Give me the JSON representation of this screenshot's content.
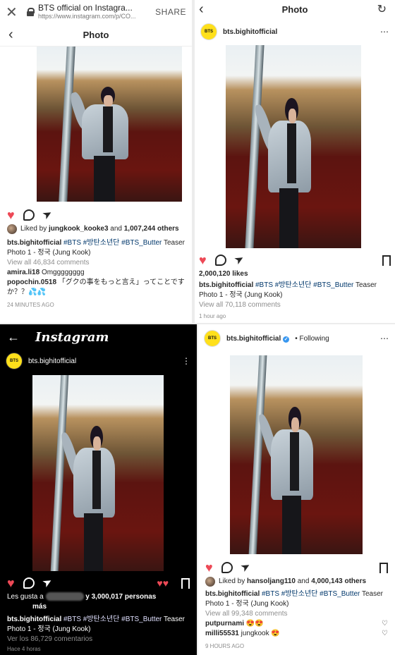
{
  "p1": {
    "browser_title": "BTS official on Instagra...",
    "browser_url": "https://www.instagram.com/p/CO...",
    "share_label": "SHARE",
    "nav_title": "Photo",
    "liked_by_prefix": "Liked by",
    "liked_by_user": "jungkook_kooke3",
    "liked_by_and": "and",
    "liked_by_count": "1,007,244 others",
    "caption_user": "bts.bighitofficial",
    "caption_tags": "#BTS #방탄소년단 #BTS_Butter",
    "caption_rest1": "Teaser",
    "caption_rest2": "Photo 1 - 정국 (Jung Kook)",
    "view_all": "View all 46,834 comments",
    "c1_user": "amira.li18",
    "c1_text": "Omgggggggg",
    "c2_user": "popochin.0518",
    "c2_text": "「グクの事をもっと言え」ってことですか？？💦💦",
    "time": "24 MINUTES AGO"
  },
  "p2": {
    "nav_title": "Photo",
    "username": "bts.bighitofficial",
    "avatar_text": "BTS",
    "likes": "2,000,120 likes",
    "caption_user": "bts.bighitofficial",
    "caption_tags": "#BTS #방탄소년단 #BTS_Butter",
    "caption_rest1": "Teaser",
    "caption_rest2": "Photo 1 - 정국 (Jung Kook)",
    "view_all": "View all 70,118 comments",
    "time": "1 hour ago"
  },
  "p3": {
    "logo": "Instagram",
    "username": "bts.bighitofficial",
    "avatar_text": "BTS",
    "likes_prefix": "Les gusta a",
    "likes_mid": "y 3,000,017 personas",
    "likes_suffix": "más",
    "caption_user": "bts.bighitofficial",
    "caption_tags": "#BTS #방탄소년단 #BTS_Butter",
    "caption_rest1": "Teaser",
    "caption_rest2": "Photo 1 - 정국 (Jung Kook)",
    "view_all": "Ver los 86,729 comentarios",
    "time": "Hace 4 horas"
  },
  "p4": {
    "username": "bts.bighitofficial",
    "avatar_text": "BTS",
    "following": "• Following",
    "liked_by_prefix": "Liked by",
    "liked_by_user": "hansoljang110",
    "liked_by_and": "and",
    "liked_by_count": "4,000,143 others",
    "caption_user": "bts.bighitofficial",
    "caption_tags": "#BTS #방탄소년단 #BTS_Butter",
    "caption_rest1": "Teaser",
    "caption_rest2": "Photo 1 - 정국 (Jung Kook)",
    "view_all": "View all 99,348 comments",
    "c1_user": "putpurnami",
    "c1_text": "😍😍",
    "c2_user": "milli55531",
    "c2_text": "jungkook 😍",
    "time": "9 HOURS AGO"
  },
  "colors": {
    "like_red": "#ed4956",
    "tag_blue": "#00376b",
    "bts_yellow": "#ffe01b"
  }
}
